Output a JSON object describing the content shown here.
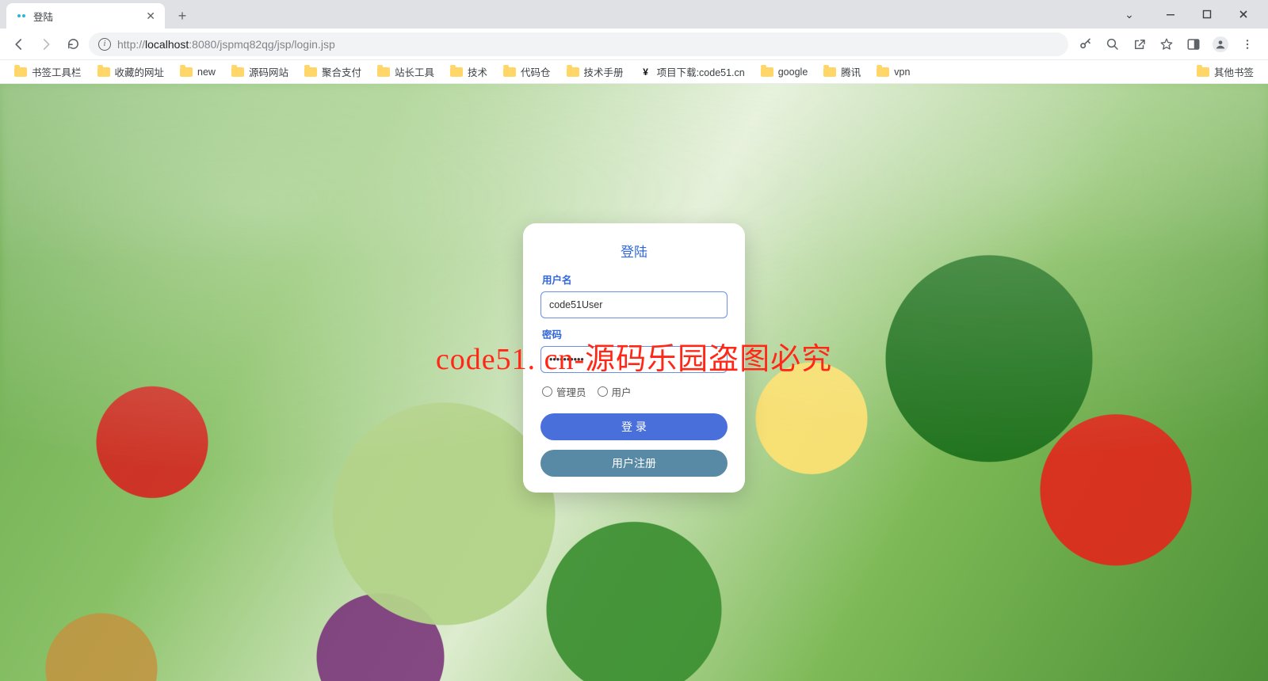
{
  "browser": {
    "tab_title": "登陆",
    "url_full": "http://localhost:8080/jspmq82qg/jsp/login.jsp",
    "url_pre": "http://",
    "url_host": "localhost",
    "url_port_path": ":8080/jspmq82qg/jsp/login.jsp"
  },
  "bookmarks": {
    "items": [
      "书签工具栏",
      "收藏的网址",
      "new",
      "源码网站",
      "聚合支付",
      "站长工具",
      "技术",
      "代码仓",
      "技术手册",
      "项目下载:code51.cn",
      "google",
      "腾讯",
      "vpn"
    ],
    "overflow": "其他书签"
  },
  "login": {
    "title": "登陆",
    "username_label": "用户名",
    "username_value": "code51User",
    "password_label": "密码",
    "password_value": "••••••••••",
    "radio_admin": "管理员",
    "radio_user": "用户",
    "login_btn": "登 录",
    "register_btn": "用户注册"
  },
  "watermark": "code51. cn-源码乐园盗图必究"
}
